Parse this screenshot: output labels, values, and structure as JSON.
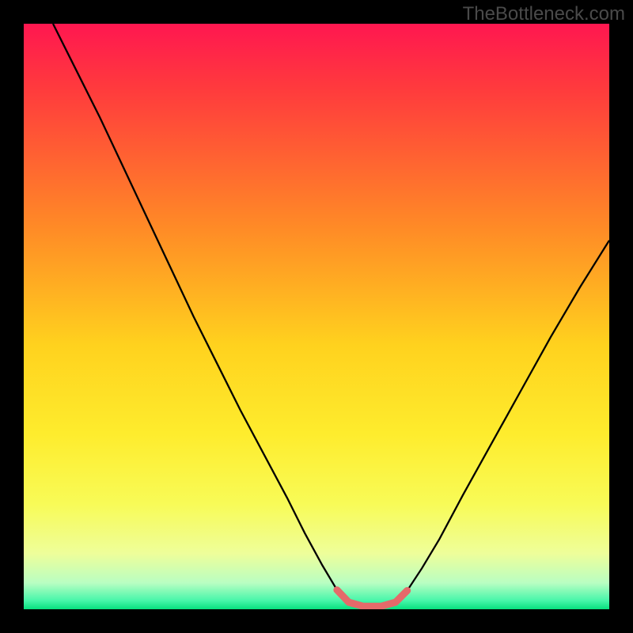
{
  "watermark": "TheBottleneck.com",
  "chart_data": {
    "type": "line",
    "title": "",
    "xlabel": "",
    "ylabel": "",
    "xlim": [
      0,
      100
    ],
    "ylim": [
      0,
      100
    ],
    "gradient_stops": [
      {
        "offset": 0.0,
        "color": "#ff1750"
      },
      {
        "offset": 0.11,
        "color": "#ff3a3d"
      },
      {
        "offset": 0.35,
        "color": "#ff8b26"
      },
      {
        "offset": 0.55,
        "color": "#ffd21e"
      },
      {
        "offset": 0.7,
        "color": "#feec2d"
      },
      {
        "offset": 0.82,
        "color": "#f8fb57"
      },
      {
        "offset": 0.905,
        "color": "#eefe9a"
      },
      {
        "offset": 0.955,
        "color": "#b9fec2"
      },
      {
        "offset": 0.985,
        "color": "#48f6aa"
      },
      {
        "offset": 1.0,
        "color": "#07e07e"
      }
    ],
    "series": [
      {
        "name": "bottleneck-curve",
        "color": "#000000",
        "stroke_width": 2.3,
        "points": [
          {
            "x": 5.0,
            "y": 100.0
          },
          {
            "x": 9.0,
            "y": 92.0
          },
          {
            "x": 13.0,
            "y": 84.0
          },
          {
            "x": 17.0,
            "y": 75.5
          },
          {
            "x": 21.0,
            "y": 67.0
          },
          {
            "x": 25.0,
            "y": 58.5
          },
          {
            "x": 29.0,
            "y": 50.0
          },
          {
            "x": 33.0,
            "y": 42.0
          },
          {
            "x": 37.0,
            "y": 34.0
          },
          {
            "x": 41.0,
            "y": 26.5
          },
          {
            "x": 45.0,
            "y": 19.0
          },
          {
            "x": 48.0,
            "y": 13.0
          },
          {
            "x": 51.0,
            "y": 7.5
          },
          {
            "x": 53.5,
            "y": 3.3
          },
          {
            "x": 55.5,
            "y": 1.2
          },
          {
            "x": 58.0,
            "y": 0.5
          },
          {
            "x": 61.0,
            "y": 0.5
          },
          {
            "x": 63.5,
            "y": 1.2
          },
          {
            "x": 65.5,
            "y": 3.2
          },
          {
            "x": 68.0,
            "y": 7.0
          },
          {
            "x": 71.0,
            "y": 12.0
          },
          {
            "x": 75.0,
            "y": 19.5
          },
          {
            "x": 80.0,
            "y": 28.5
          },
          {
            "x": 85.0,
            "y": 37.5
          },
          {
            "x": 90.0,
            "y": 46.5
          },
          {
            "x": 95.0,
            "y": 55.0
          },
          {
            "x": 100.0,
            "y": 63.0
          }
        ]
      },
      {
        "name": "optimal-zone-marker",
        "color": "#e56a6a",
        "stroke_width": 9,
        "linecap": "round",
        "points": [
          {
            "x": 53.5,
            "y": 3.3
          },
          {
            "x": 55.5,
            "y": 1.2
          },
          {
            "x": 58.0,
            "y": 0.5
          },
          {
            "x": 61.0,
            "y": 0.5
          },
          {
            "x": 63.5,
            "y": 1.2
          },
          {
            "x": 65.5,
            "y": 3.2
          }
        ]
      }
    ]
  }
}
